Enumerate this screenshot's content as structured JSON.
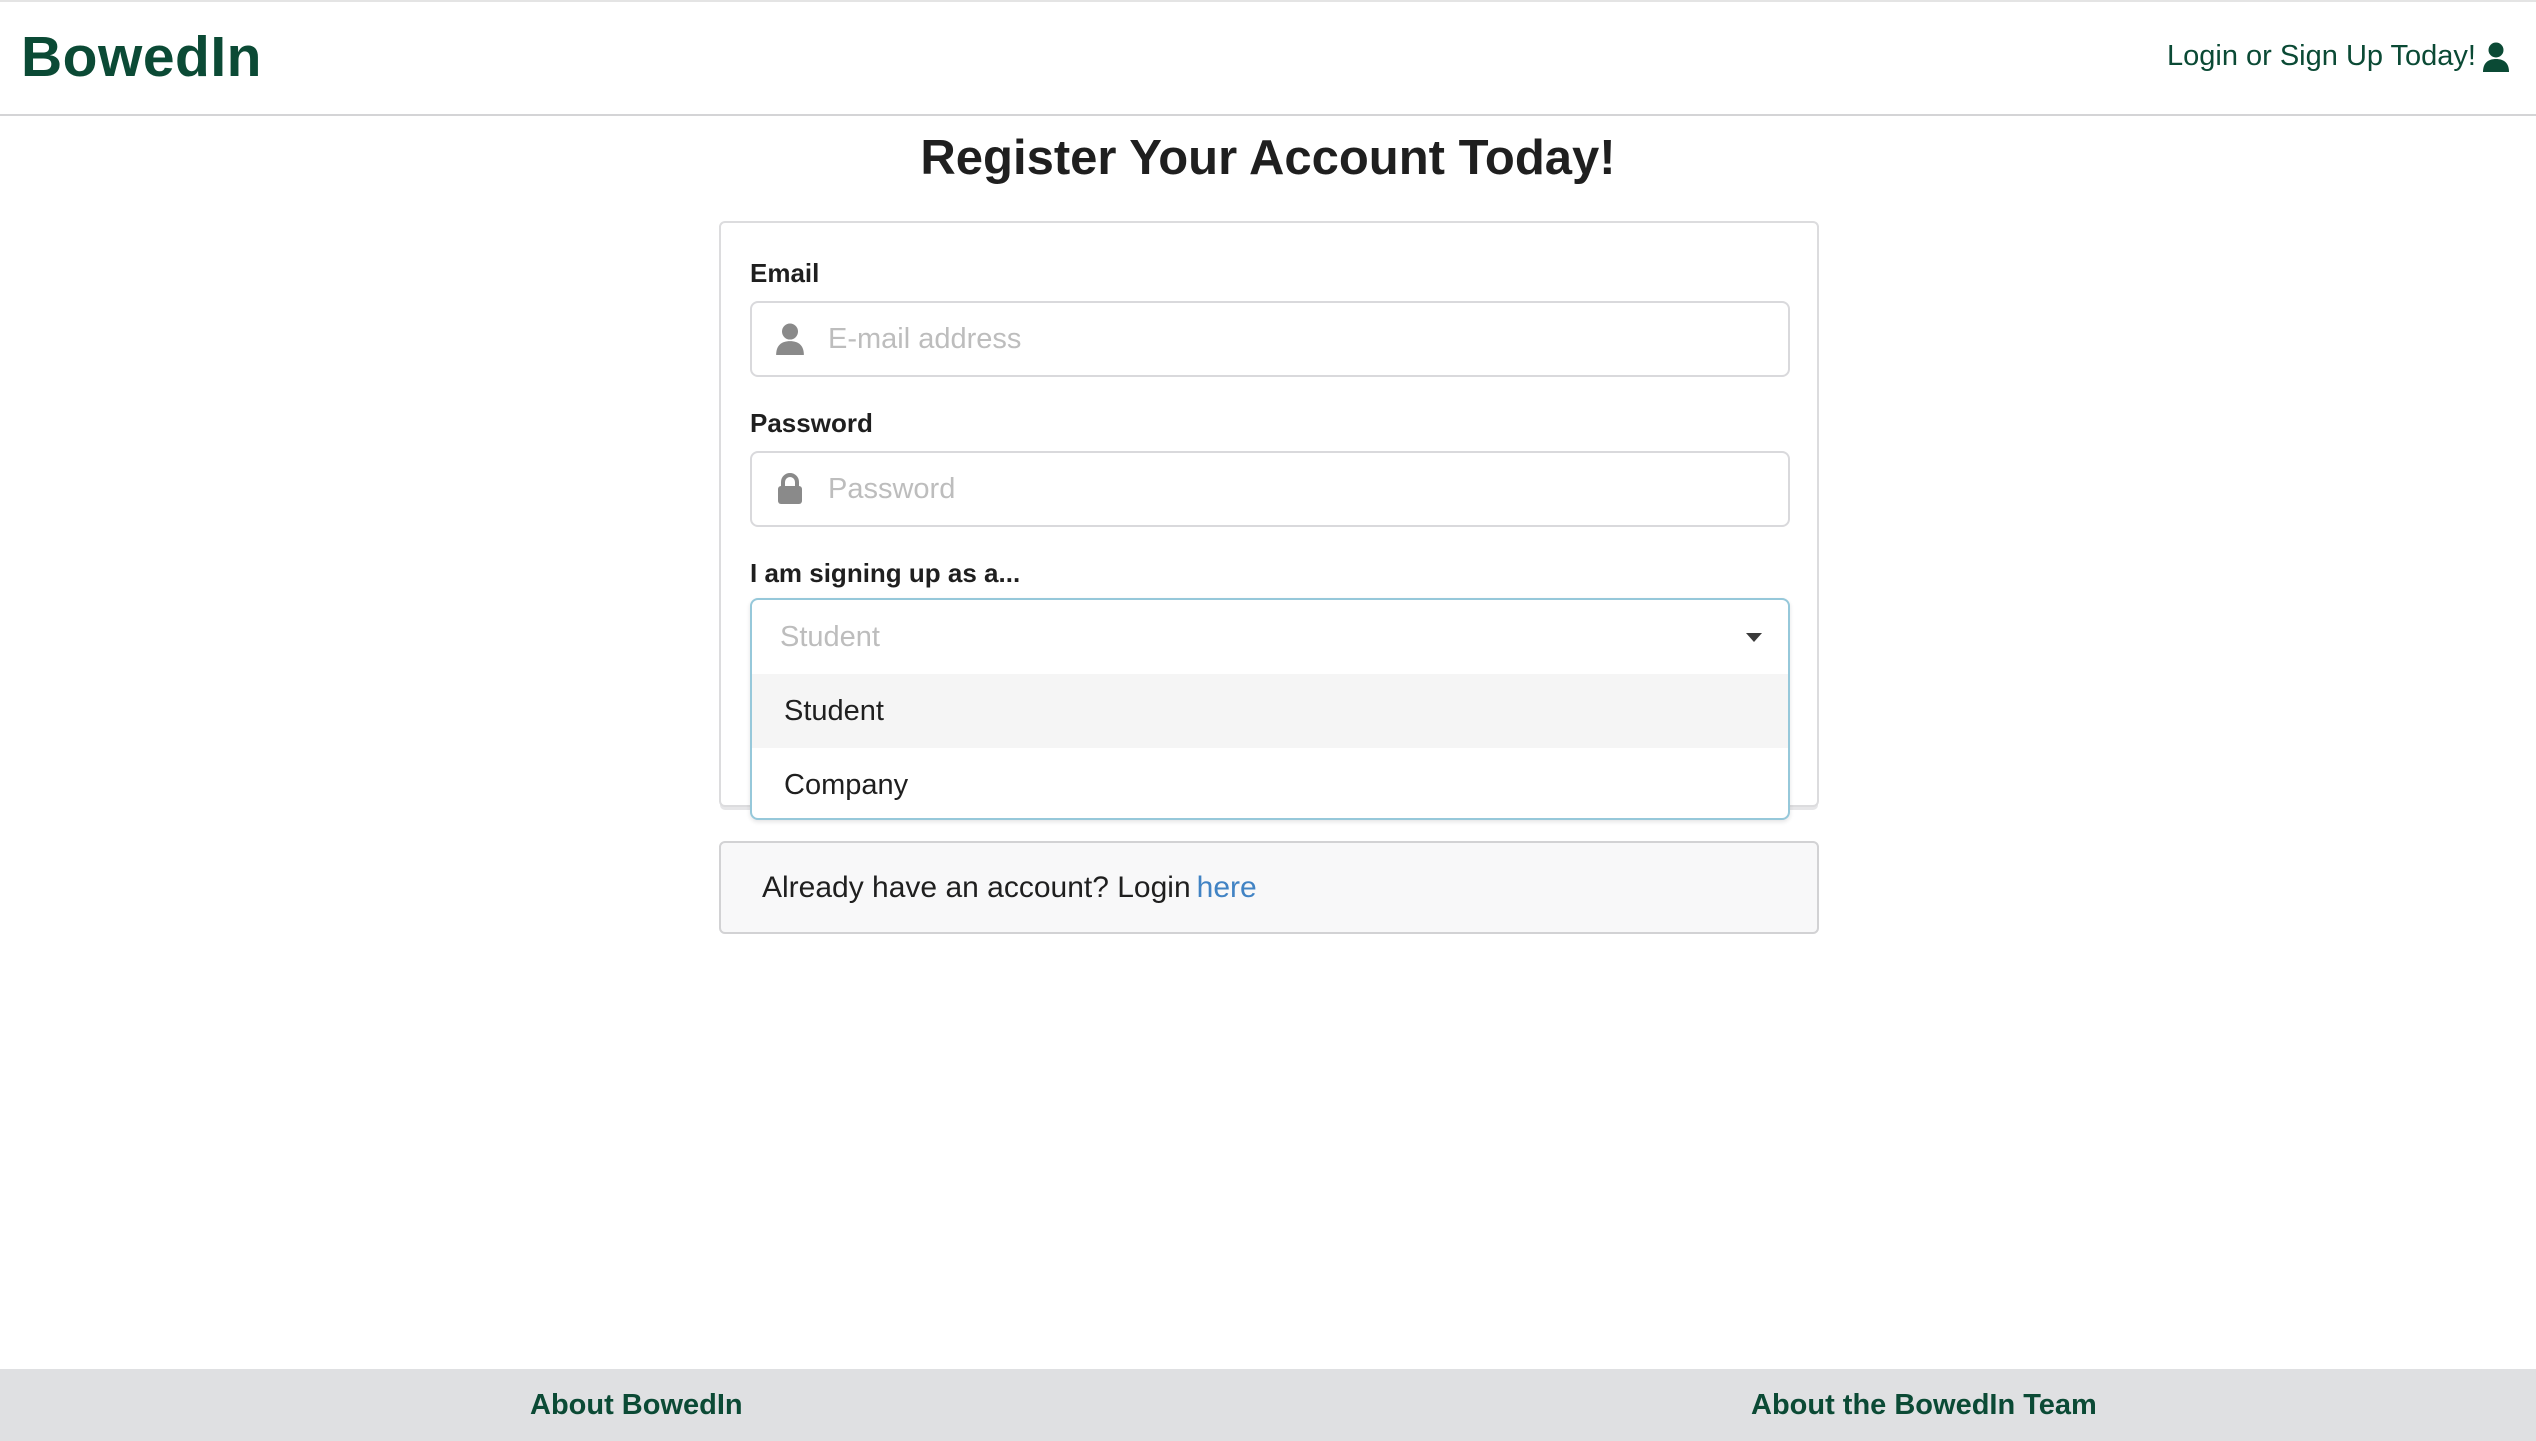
{
  "header": {
    "brand": "BowedIn",
    "login_label": "Login or Sign Up Today!"
  },
  "page": {
    "title": "Register Your Account Today!"
  },
  "form": {
    "email": {
      "label": "Email",
      "placeholder": "E-mail address",
      "value": ""
    },
    "password": {
      "label": "Password",
      "placeholder": "Password",
      "value": ""
    },
    "role": {
      "label": "I am signing up as a...",
      "placeholder": "Student",
      "options": [
        "Student",
        "Company"
      ],
      "highlighted_index": 0,
      "open": true
    }
  },
  "login_prompt": {
    "text": "Already have an account? Login",
    "link": "here"
  },
  "footer": {
    "left_link": "About BowedIn",
    "right_link": "About the BowedIn Team"
  },
  "colors": {
    "brand": "#0b4a35",
    "link": "#4183c4",
    "focus_border": "#96c8da",
    "footer_bg": "#dfe0e2"
  }
}
